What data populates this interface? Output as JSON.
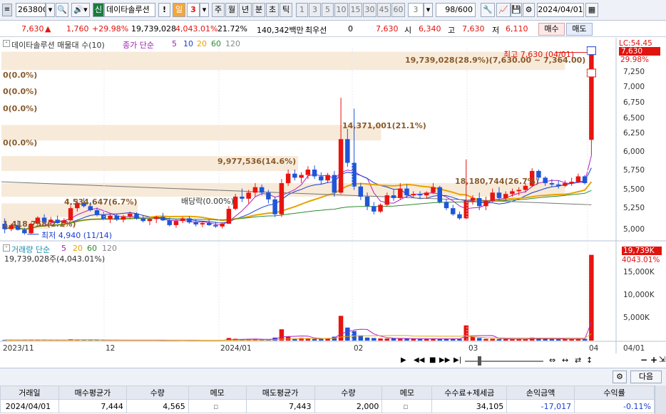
{
  "toolbar": {
    "code": "263800",
    "name": "데이타솔루션",
    "sin": "신",
    "excl": "!",
    "il": "일",
    "num": "3",
    "periods": [
      "주",
      "월",
      "년",
      "분",
      "초",
      "틱"
    ],
    "minutes": [
      "1",
      "3",
      "5",
      "10",
      "15",
      "30",
      "45",
      "60"
    ],
    "field": "3",
    "range": "98/600",
    "date": "2024/04/01"
  },
  "quote": {
    "price": "7,630",
    "arrow": "▲",
    "change": "1,760",
    "pct": "+29.98%",
    "volume": "19,739,028",
    "volpct": "4,043.01%",
    "turnover": "21.72%",
    "amount": "140,342백만",
    "priority": "최우선",
    "zero": "0",
    "bid": "7,630",
    "open_l": "시",
    "open": "6,340",
    "high_l": "고",
    "high": "7,630",
    "low_l": "저",
    "low": "6,110",
    "buy": "매수",
    "sell": "매도"
  },
  "chart": {
    "title": "데이타솔루션 매물대 수(10)",
    "ma_label": "종가 단순",
    "ma_periods": [
      "5",
      "10",
      "20",
      "60",
      "120"
    ],
    "profile": [
      "0(0.0%)",
      "0(0.0%)",
      "0(0.0%)",
      "0(0.0%)",
      "9,977,536(14.6%)",
      "4,534,647(6.7%)",
      "1,418,758(2.1%)",
      "14,371,001(21.1%)",
      "18,180,744(26.7%)",
      "19,739,028(28.9%)(7,630.00 ~ 7,364.00)"
    ],
    "high_label": "최고 7,630 (04/01)",
    "low_label": "최저 4,940 (11/14)",
    "event": "배당락(0.00%)",
    "current": "7,630",
    "lc": "LC:54.45",
    "pct": "29.98%",
    "price_axis": [
      "7,250",
      "7,000",
      "6,750",
      "6,500",
      "6,250",
      "6,000",
      "5,750",
      "5,500",
      "5,250",
      "5,000"
    ],
    "vol_title": "거래량 단순",
    "vol_ma": [
      "5",
      "20",
      "60",
      "120"
    ],
    "vol_summary": "19,739,028주(4,043.01%)",
    "vol_current": "19,739K",
    "vol_pct": "4043.01%",
    "vol_axis": [
      "15,000K",
      "10,000K",
      "5,000K"
    ],
    "dates": [
      "2023/11",
      "12",
      "2024/01",
      "02",
      "03",
      "04",
      "04/01"
    ],
    "next": "다음"
  },
  "chart_data": {
    "type": "candlestick",
    "title": "데이타솔루션",
    "yrange": [
      4900,
      7700
    ],
    "ohlc": [
      [
        5100,
        5180,
        4960,
        5020
      ],
      [
        5020,
        5100,
        4990,
        5080
      ],
      [
        5080,
        5150,
        5000,
        5010
      ],
      [
        5010,
        5040,
        4940,
        4960
      ],
      [
        4960,
        5120,
        4950,
        5100
      ],
      [
        5100,
        5210,
        5080,
        5190
      ],
      [
        5190,
        5240,
        5100,
        5120
      ],
      [
        5120,
        5200,
        5080,
        5160
      ],
      [
        5160,
        5220,
        5100,
        5110
      ],
      [
        5110,
        5180,
        5050,
        5150
      ],
      [
        5150,
        5360,
        5140,
        5330
      ],
      [
        5330,
        5460,
        5280,
        5410
      ],
      [
        5410,
        5480,
        5340,
        5360
      ],
      [
        5360,
        5420,
        5280,
        5300
      ],
      [
        5300,
        5340,
        5210,
        5230
      ],
      [
        5230,
        5280,
        5150,
        5170
      ],
      [
        5170,
        5240,
        5110,
        5220
      ],
      [
        5220,
        5250,
        5140,
        5160
      ],
      [
        5160,
        5230,
        5120,
        5210
      ],
      [
        5210,
        5280,
        5180,
        5250
      ],
      [
        5250,
        5270,
        5160,
        5180
      ],
      [
        5180,
        5230,
        5120,
        5140
      ],
      [
        5140,
        5190,
        5080,
        5170
      ],
      [
        5170,
        5220,
        5110,
        5200
      ],
      [
        5200,
        5260,
        5140,
        5150
      ],
      [
        5150,
        5190,
        5060,
        5080
      ],
      [
        5080,
        5160,
        5040,
        5140
      ],
      [
        5140,
        5200,
        5110,
        5180
      ],
      [
        5180,
        5210,
        5100,
        5120
      ],
      [
        5120,
        5170,
        5060,
        5090
      ],
      [
        5090,
        5140,
        5050,
        5110
      ],
      [
        5110,
        5160,
        5070,
        5080
      ],
      [
        5080,
        5130,
        5040,
        5060
      ],
      [
        5060,
        5120,
        5030,
        5100
      ],
      [
        5100,
        5360,
        5100,
        5320
      ],
      [
        5320,
        5540,
        5300,
        5500
      ],
      [
        5500,
        5620,
        5420,
        5470
      ],
      [
        5470,
        5600,
        5400,
        5560
      ],
      [
        5560,
        5700,
        5500,
        5640
      ],
      [
        5640,
        5680,
        5520,
        5560
      ],
      [
        5560,
        5600,
        5400,
        5460
      ],
      [
        5460,
        5500,
        5200,
        5240
      ],
      [
        5240,
        5760,
        5200,
        5700
      ],
      [
        5700,
        5900,
        5660,
        5840
      ],
      [
        5840,
        5900,
        5740,
        5780
      ],
      [
        5780,
        5860,
        5700,
        5820
      ],
      [
        5820,
        5950,
        5760,
        5900
      ],
      [
        5900,
        5960,
        5760,
        5800
      ],
      [
        5800,
        5860,
        5680,
        5740
      ],
      [
        5740,
        5850,
        5700,
        5820
      ],
      [
        5820,
        5880,
        5500,
        5560
      ],
      [
        5560,
        6960,
        5540,
        6350
      ],
      [
        6350,
        6500,
        5940,
        6000
      ],
      [
        6000,
        6800,
        5600,
        5650
      ],
      [
        5650,
        5700,
        5450,
        5500
      ],
      [
        5500,
        5560,
        5300,
        5360
      ],
      [
        5360,
        5420,
        5240,
        5280
      ],
      [
        5280,
        5400,
        5260,
        5380
      ],
      [
        5380,
        5560,
        5360,
        5520
      ],
      [
        5520,
        5600,
        5440,
        5480
      ],
      [
        5480,
        5700,
        5460,
        5620
      ],
      [
        5620,
        5680,
        5480,
        5520
      ],
      [
        5520,
        5580,
        5480,
        5540
      ],
      [
        5540,
        5580,
        5480,
        5520
      ],
      [
        5520,
        5580,
        5470,
        5560
      ],
      [
        5560,
        5700,
        5540,
        5640
      ],
      [
        5640,
        5660,
        5400,
        5420
      ],
      [
        5420,
        5460,
        5300,
        5330
      ],
      [
        5330,
        5380,
        5220,
        5240
      ],
      [
        5240,
        5280,
        5160,
        5180
      ],
      [
        5180,
        6050,
        5170,
        5440
      ],
      [
        5440,
        5520,
        5380,
        5480
      ],
      [
        5480,
        5560,
        5300,
        5360
      ],
      [
        5360,
        5500,
        5300,
        5440
      ],
      [
        5440,
        5620,
        5420,
        5560
      ],
      [
        5560,
        5640,
        5440,
        5480
      ],
      [
        5480,
        5580,
        5440,
        5540
      ],
      [
        5540,
        5620,
        5500,
        5580
      ],
      [
        5580,
        5640,
        5520,
        5600
      ],
      [
        5600,
        5700,
        5560,
        5660
      ],
      [
        5660,
        5920,
        5640,
        5880
      ],
      [
        5880,
        5900,
        5740,
        5780
      ],
      [
        5780,
        5800,
        5660,
        5700
      ],
      [
        5700,
        5760,
        5640,
        5680
      ],
      [
        5680,
        5740,
        5620,
        5660
      ],
      [
        5660,
        5740,
        5640,
        5700
      ],
      [
        5700,
        5780,
        5660,
        5720
      ],
      [
        5720,
        5840,
        5700,
        5800
      ],
      [
        5800,
        5820,
        5680,
        5700
      ],
      [
        6340,
        7630,
        6110,
        7630
      ]
    ],
    "volume_k": [
      150,
      90,
      110,
      200,
      180,
      120,
      100,
      90,
      80,
      110,
      300,
      260,
      140,
      120,
      100,
      90,
      80,
      70,
      80,
      90,
      80,
      70,
      60,
      80,
      70,
      60,
      90,
      70,
      60,
      60,
      60,
      60,
      70,
      80,
      600,
      420,
      300,
      260,
      320,
      240,
      260,
      700,
      2600,
      900,
      500,
      600,
      560,
      480,
      400,
      420,
      900,
      5700,
      3000,
      2200,
      1200,
      700,
      600,
      500,
      480,
      520,
      420,
      500,
      400,
      380,
      360,
      480,
      420,
      400,
      380,
      360,
      3500,
      900,
      600,
      400,
      420,
      380,
      360,
      340,
      320,
      360,
      700,
      480,
      400,
      380,
      360,
      360,
      380,
      420,
      400,
      19739
    ]
  }
}
